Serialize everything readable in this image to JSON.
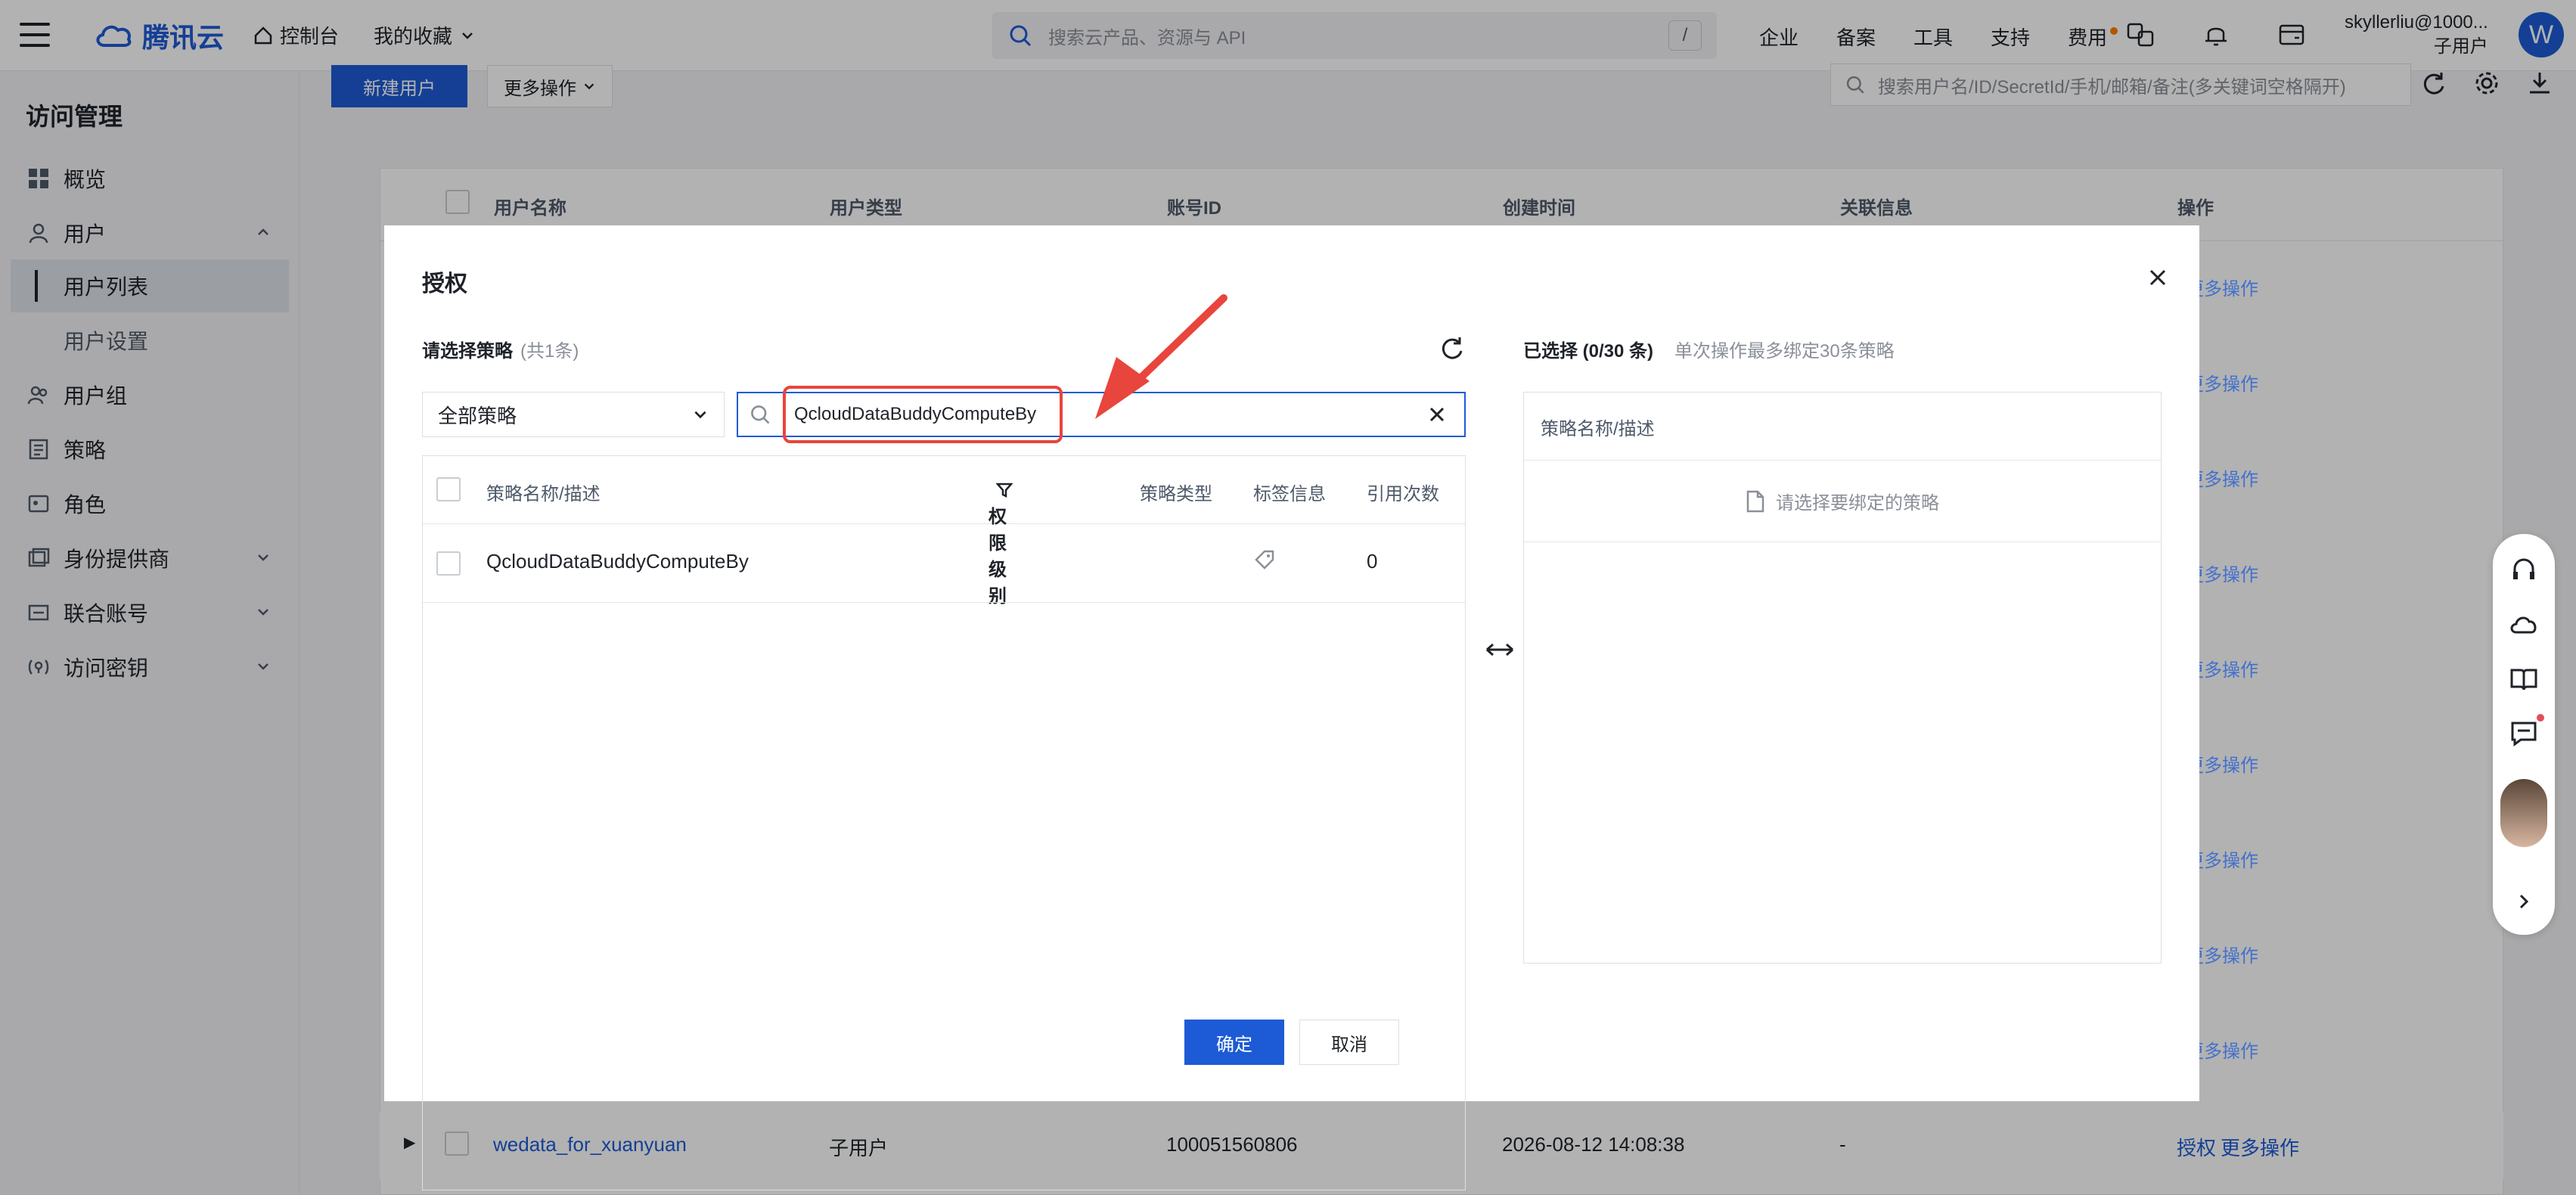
{
  "topbar": {
    "brand": "腾讯云",
    "console": "控制台",
    "favorites": "我的收藏",
    "search_placeholder": "搜索云产品、资源与 API",
    "search_key": "/",
    "nav": [
      "企业",
      "备案",
      "工具",
      "支持",
      "费用"
    ],
    "user_account": "skyllerliu@1000...",
    "user_role": "子用户",
    "avatar_letter": "W"
  },
  "sidebar": {
    "title": "访问管理",
    "items": [
      {
        "label": "概览"
      },
      {
        "label": "用户"
      },
      {
        "label": "用户列表"
      },
      {
        "label": "用户设置"
      },
      {
        "label": "用户组"
      },
      {
        "label": "策略"
      },
      {
        "label": "角色"
      },
      {
        "label": "身份提供商"
      },
      {
        "label": "联合账号"
      },
      {
        "label": "访问密钥"
      }
    ]
  },
  "main": {
    "new_user": "新建用户",
    "more_ops": "更多操作",
    "search_placeholder": "搜索用户名/ID/SecretId/手机/邮箱/备注(多关键词空格隔开)",
    "columns": [
      "用户名称",
      "用户类型",
      "账号ID",
      "创建时间",
      "关联信息",
      "操作"
    ],
    "row_action_auth": "授权",
    "row_action_more": "更多操作",
    "last_row": {
      "name": "wedata_for_xuanyuan",
      "type": "子用户",
      "account_id": "100051560806",
      "created": "2026-08-12 14:08:38",
      "related": "-"
    }
  },
  "modal": {
    "title": "授权",
    "select_label": "请选择策略",
    "select_count": "(共1条)",
    "policy_scope": "全部策略",
    "search_value": "QcloudDataBuddyComputeBy",
    "table_columns": [
      "策略名称/描述",
      "权限级别",
      "策略类型",
      "标签信息",
      "引用次数"
    ],
    "rows": [
      {
        "name": "QcloudDataBuddyComputeBy",
        "level": "-",
        "type": "",
        "refs": "0"
      }
    ],
    "selected_label": "已选择 (0/30 条)",
    "selected_hint": "单次操作最多绑定30条策略",
    "selected_column": "策略名称/描述",
    "empty_text": "请选择要绑定的策略",
    "ok": "确定",
    "cancel": "取消"
  }
}
